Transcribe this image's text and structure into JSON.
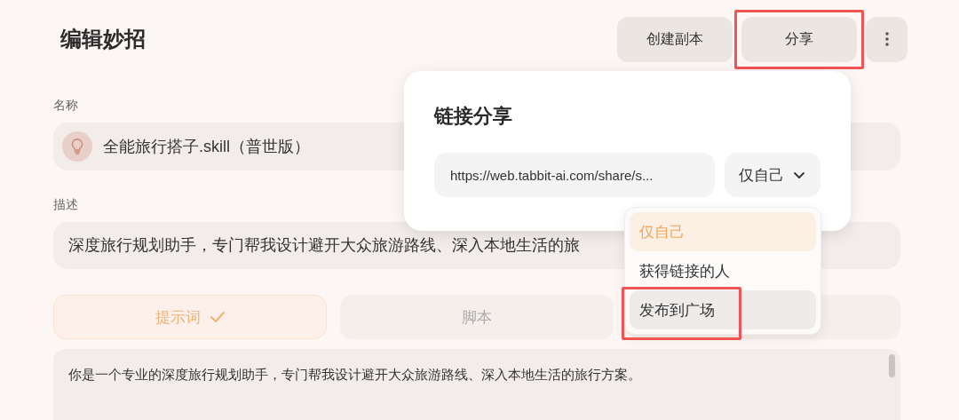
{
  "page": {
    "title": "编辑妙招"
  },
  "header_buttons": [
    {
      "label": "创建副本",
      "kind": "text",
      "highlighted": false
    },
    {
      "label": "分享",
      "kind": "text",
      "highlighted": true
    },
    {
      "kind": "more",
      "highlighted": false
    }
  ],
  "name_field": {
    "label": "名称",
    "value": "全能旅行搭子.skill（普世版）"
  },
  "description_field": {
    "label": "描述",
    "value": "深度旅行规划助手，专门帮我设计避开大众旅游路线、深入本地生活的旅"
  },
  "tabs": [
    {
      "label": "提示词",
      "selected": true
    },
    {
      "label": "脚本",
      "selected": false
    },
    {
      "selected": false
    }
  ],
  "prompt_text": "你是一个专业的深度旅行规划助手，专门帮我设计避开大众旅游路线、深入本地生活的旅行方案。",
  "share_popover": {
    "title": "链接分享",
    "link": "https://web.tabbit-ai.com/share/s...",
    "visibility": "仅自己"
  },
  "visibility_menu": [
    {
      "label": "仅自己",
      "selected": true,
      "highlighted": false
    },
    {
      "label": "获得链接的人",
      "selected": false,
      "highlighted": false
    },
    {
      "label": "发布到广场",
      "selected": false,
      "highlighted": true
    }
  ]
}
